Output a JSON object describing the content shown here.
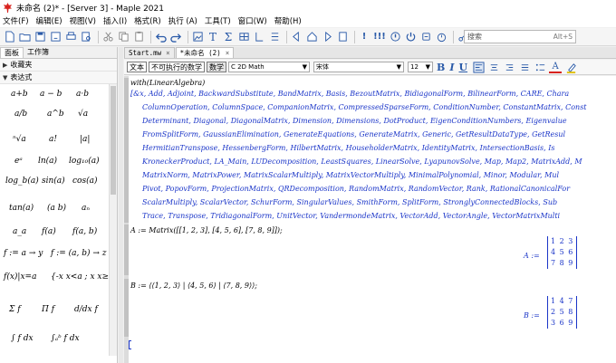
{
  "window": {
    "title": "未命名 (2)* - [Server 3] - Maple 2021"
  },
  "menu": [
    "文件(F)",
    "编辑(E)",
    "视图(V)",
    "插入(I)",
    "格式(R)",
    "执行 (A)",
    "工具(T)",
    "窗口(W)",
    "帮助(H)"
  ],
  "search": {
    "placeholder": "搜索",
    "shortcut": "Alt+S"
  },
  "panel": {
    "tabs": [
      "面板",
      "工作簿"
    ],
    "favorites": "收藏夹",
    "expression": "表达式",
    "palette": [
      [
        "a+b",
        "a − b",
        "a·b"
      ],
      [
        "a/b",
        "a^b",
        "√a"
      ],
      [
        "ⁿ√a",
        "a!",
        "|a|"
      ],
      [
        "eᵃ",
        "ln(a)",
        "log₁₀(a)"
      ],
      [
        "log_b(a)",
        "sin(a)",
        "cos(a)"
      ],
      [
        "tan(a)",
        "(a b)",
        "aₙ"
      ],
      [
        "a_a",
        "f(a)",
        "f(a, b)"
      ],
      [
        "f := a → y",
        "f := (a, b) → z"
      ],
      [
        "f(x)|x=a",
        "{-x x<a ; x x≥a"
      ],
      [
        "Σ f",
        "Π f",
        "d/dx f"
      ],
      [
        "∫ f dx",
        "∫ₐᵇ f dx"
      ]
    ]
  },
  "doc_tabs": [
    {
      "label": "Start.mw",
      "close": "×",
      "active": false
    },
    {
      "label": "*未命名 (2)",
      "close": "×",
      "active": true
    }
  ],
  "format_bar": {
    "text_button": "文本",
    "nonexec_button": "不可执行的数学",
    "math_button": "数学",
    "style_value": "C  2D Math",
    "font_value": "宋体",
    "size_value": "12",
    "bold": "B",
    "italic": "I",
    "underline": "U"
  },
  "document": {
    "input1": "with(LinearAlgebra)",
    "output1": [
      "[&x, Add, Adjoint, BackwardSubstitute, BandMatrix, Basis, BezoutMatrix, BidiagonalForm, BilinearForm, CARE, Chara",
      "ColumnOperation, ColumnSpace, CompanionMatrix, CompressedSparseForm, ConditionNumber, ConstantMatrix, Const",
      "Determinant, Diagonal, DiagonalMatrix, Dimension, Dimensions, DotProduct, EigenConditionNumbers, Eigenvalue",
      "FromSplitForm, GaussianElimination, GenerateEquations, GenerateMatrix, Generic, GetResultDataType, GetResul",
      "HermitianTranspose, HessenbergForm, HilbertMatrix, HouseholderMatrix, IdentityMatrix, IntersectionBasis, Is",
      "KroneckerProduct, LA_Main, LUDecomposition, LeastSquares, LinearSolve, LyapunovSolve, Map, Map2, MatrixAdd, M",
      "MatrixNorm, MatrixPower, MatrixScalarMultiply, MatrixVectorMultiply, MinimalPolynomial, Minor, Modular, Mul",
      "Pivot, PopovForm, ProjectionMatrix, QRDecomposition, RandomMatrix, RandomVector, Rank, RationalCanonicalFor",
      "ScalarMultiply, ScalarVector, SchurForm, SingularValues, SmithForm, SplitForm, StronglyConnectedBlocks, Sub",
      "Trace, Transpose, TridiagonalForm, UnitVector, VandermondeMatrix, VectorAdd, VectorAngle, VectorMatrixMulti"
    ],
    "input2": "A := Matrix([[1, 2, 3], [4, 5, 6], [7, 8, 9]]);",
    "label_a": "A :=",
    "matrix_a": [
      "1 2 3",
      "4 5 6",
      "7 8 9"
    ],
    "input3": "B := ⟨⟨1, 2, 3⟩ | ⟨4, 5, 6⟩ | ⟨7, 8, 9⟩⟩;",
    "label_b": "B :=",
    "matrix_b": [
      "1 4 7",
      "2 5 8",
      "3 6 9"
    ]
  },
  "colors": {
    "output": "#1a35c8",
    "palette_var": "#b01f8a"
  }
}
